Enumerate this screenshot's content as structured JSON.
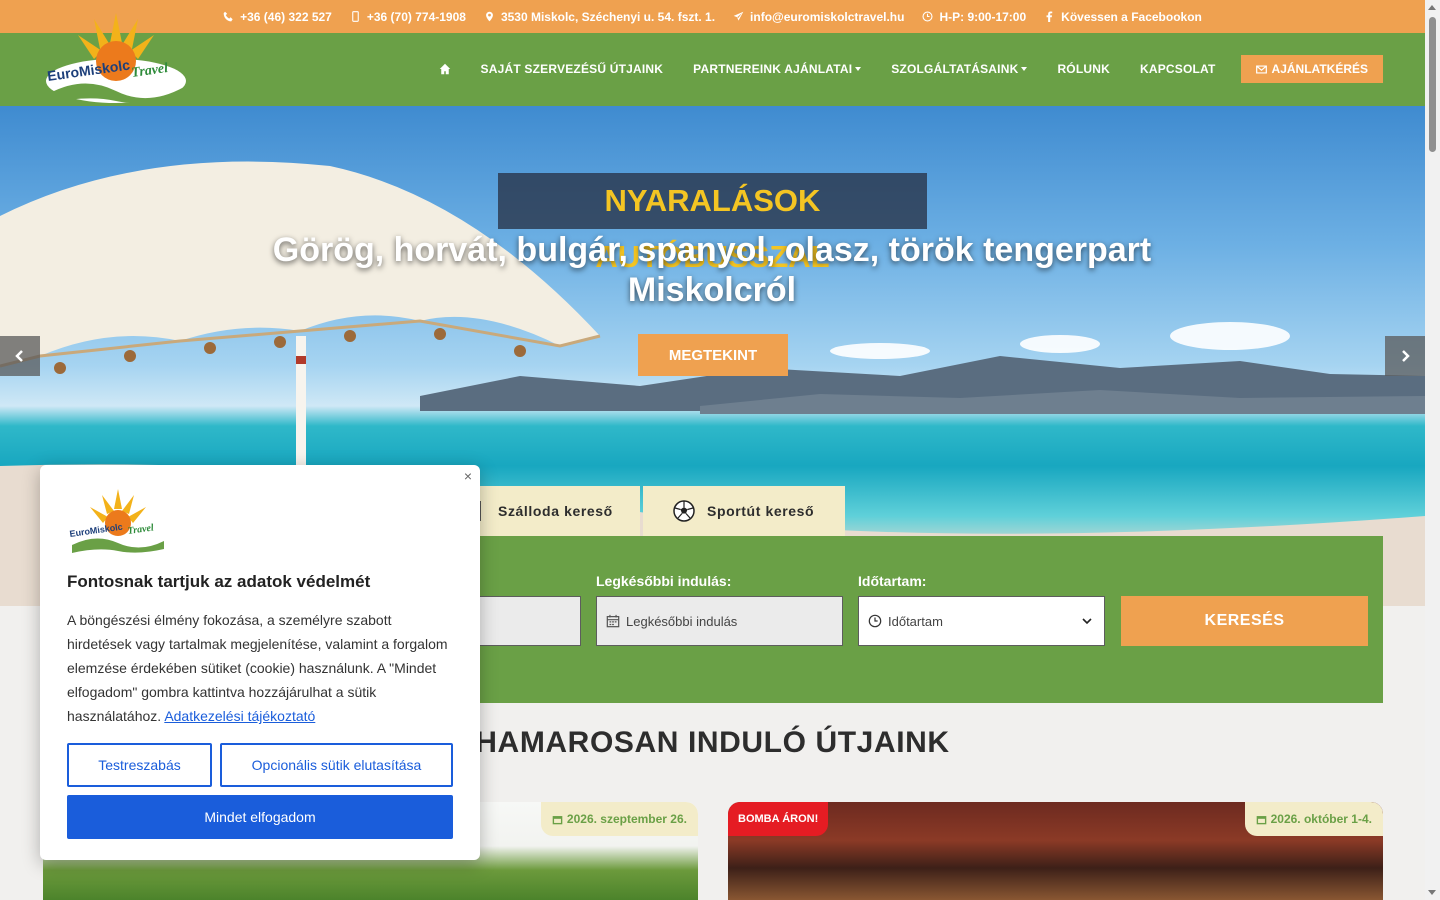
{
  "topbar": {
    "phone1": "+36 (46) 322 527",
    "phone2": "+36 (70) 774-1908",
    "address": "3530 Miskolc, Széchenyi u. 54. fszt. 1.",
    "email": "info@euromiskolctravel.hu",
    "hours": "H-P: 9:00-17:00",
    "facebook": "Kövessen a Facebookon"
  },
  "brand": {
    "logo_text": "EuroMiskolc Travel"
  },
  "nav": {
    "items": [
      {
        "label": "SAJÁT SZERVEZÉSŰ ÚTJAINK",
        "dropdown": false
      },
      {
        "label": "PARTNEREINK AJÁNLATAI",
        "dropdown": true
      },
      {
        "label": "SZOLGÁLTATÁSAINK",
        "dropdown": true
      },
      {
        "label": "RÓLUNK",
        "dropdown": false
      },
      {
        "label": "KAPCSOLAT",
        "dropdown": false
      }
    ],
    "offer_button": "AJÁNLATKÉRÉS"
  },
  "hero": {
    "title": "NYARALÁSOK AUTÓBUSSZAL",
    "subtitle": "Görög, horvát, bulgár, spanyol, olasz, török tengerpart Miskolcról",
    "cta": "MEGTEKINT"
  },
  "search": {
    "tabs": [
      {
        "label": "Szálloda kereső",
        "icon": "hotel-icon"
      },
      {
        "label": "Sportút kereső",
        "icon": "soccer-ball-icon"
      }
    ],
    "latest_label": "Legkésőbbi indulás:",
    "latest_placeholder": "Legkésőbbi indulás",
    "duration_label": "Időtartam:",
    "duration_placeholder": "Időtartam",
    "button": "KERESÉS"
  },
  "section": {
    "title": "HAMAROSAN INDULÓ ÚTJAINK"
  },
  "cards": [
    {
      "date": "2026. szeptember 26.",
      "badge": ""
    },
    {
      "date": "2026. október 1-4.",
      "badge": "BOMBA ÁRON!"
    }
  ],
  "cookie": {
    "title": "Fontosnak tartjuk az adatok védelmét",
    "text": "A böngészési élmény fokozása, a személyre szabott hirdetések vagy tartalmak megjelenítése, valamint a forgalom elemzése érdekében sütiket (cookie) használunk. A \"Mindet elfogadom\" gombra kattintva hozzájárulhat a sütik használatához.",
    "link": "Adatkezelési tájékoztató",
    "customize": "Testreszabás",
    "reject": "Opcionális sütik elutasítása",
    "accept": "Mindet elfogadom",
    "close": "×"
  },
  "colors": {
    "orange": "#efa150",
    "green": "#6aa046",
    "cream": "#f3ecc9",
    "title_yellow": "#f4c523",
    "cookie_blue": "#1a5ddb",
    "badge_red": "#e51c23"
  }
}
